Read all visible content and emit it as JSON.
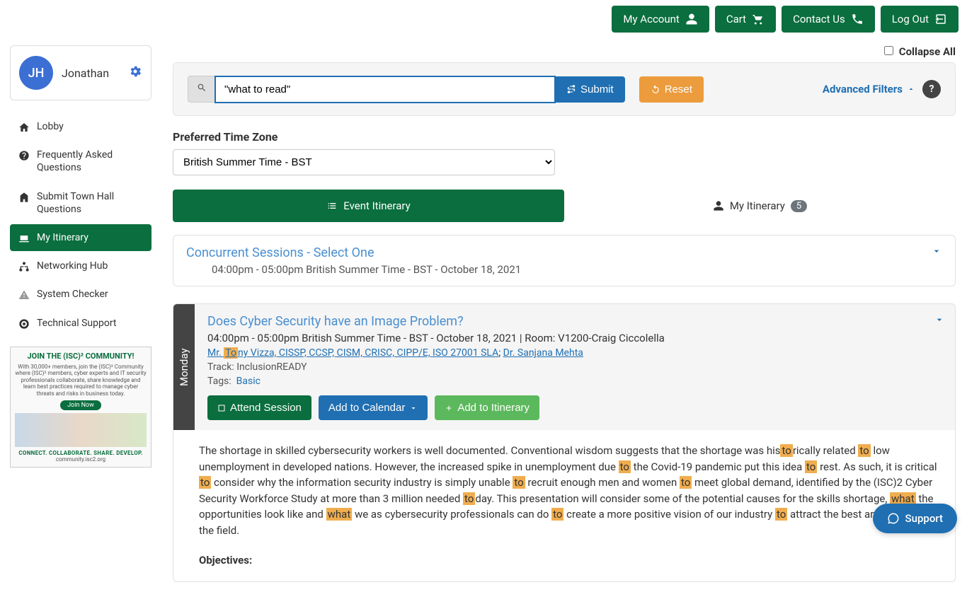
{
  "topnav": {
    "my_account": "My Account",
    "cart": "Cart",
    "contact_us": "Contact Us",
    "log_out": "Log Out"
  },
  "user": {
    "initials": "JH",
    "name": "Jonathan"
  },
  "sidenav": {
    "lobby": "Lobby",
    "faq": "Frequently Asked Questions",
    "townhall": "Submit Town Hall Questions",
    "itinerary": "My Itinerary",
    "networking": "Networking Hub",
    "system_checker": "System Checker",
    "tech_support": "Technical Support"
  },
  "promo": {
    "headline": "JOIN THE (ISC)² COMMUNITY!",
    "body": "With 30,000+ members, join the (ISC)² Community where (ISC)² members, cyber experts and IT security professionals collaborate, share knowledge and learn best practices required to manage cyber threats and risks in business today.",
    "join": "Join Now",
    "footer": "CONNECT. COLLABORATE. SHARE. DEVELOP.",
    "url": "community.isc2.org"
  },
  "collapse_all": "Collapse All",
  "search": {
    "value": "\"what to read\"",
    "submit": "Submit",
    "reset": "Reset",
    "advanced": "Advanced Filters",
    "help": "?"
  },
  "timezone": {
    "label": "Preferred Time Zone",
    "selected": "British Summer Time - BST"
  },
  "tabs": {
    "event": "Event Itinerary",
    "mine": "My Itinerary",
    "mine_count": "5"
  },
  "section": {
    "title": "Concurrent Sessions - Select One",
    "sub": "04:00pm - 05:00pm British Summer Time - BST - October 18, 2021"
  },
  "session": {
    "day": "Monday",
    "title": "Does Cyber Security have an Image Problem?",
    "meta": "04:00pm - 05:00pm British Summer Time - BST - October 18, 2021 | Room: V1200-Craig Ciccolella",
    "presenter1_pre": "Mr. ",
    "presenter1_hl": "To",
    "presenter1_post": "ny Vizza, CISSP, CCSP, CISM, CRISC, CIPP/E, ISO 27001 SLA",
    "presenter_sep": "; ",
    "presenter2": "Dr. Sanjana Mehta",
    "track_label": "Track: ",
    "track": "InclusionREADY",
    "tags_label": "Tags:",
    "tag": "Basic",
    "attend": "Attend Session",
    "calendar": "Add to Calendar",
    "add": "Add to Itinerary",
    "desc": {
      "p1": "The shortage in skilled cybersecurity workers is well documented. Conventional wisdom suggests that the shortage was his",
      "h1": "to",
      "p2": "rically related ",
      "h2": "to",
      "p3": " low unemployment in developed nations. However, the increased spike in unemployment due ",
      "h3": "to",
      "p4": " the Covid-19 pandemic put this idea ",
      "h4": "to",
      "p5": " rest. As such, it is critical ",
      "h5": "to",
      "p6": " consider why the information security industry is simply unable ",
      "h6": "to",
      "p7": " recruit enough men and women ",
      "h7": "to",
      "p8": " meet global demand, identified by the (ISC)2 Cyber Security Workforce Study at more than 3 million needed ",
      "h8": "to",
      "p9": "day. This presentation will consider some of the potential causes for the skills shortage, ",
      "h9": "what",
      "p10": " the opportunities look like and ",
      "h10": "what",
      "p11": " we as cybersecurity professionals can do ",
      "h11": "to",
      "p12": " create a more positive vision of our industry ",
      "h12": "to",
      "p13": " attract the best and brightest ",
      "h13": "to",
      "p14": " the field."
    },
    "objectives_label": "Objectives:"
  },
  "support_fab": "Support"
}
